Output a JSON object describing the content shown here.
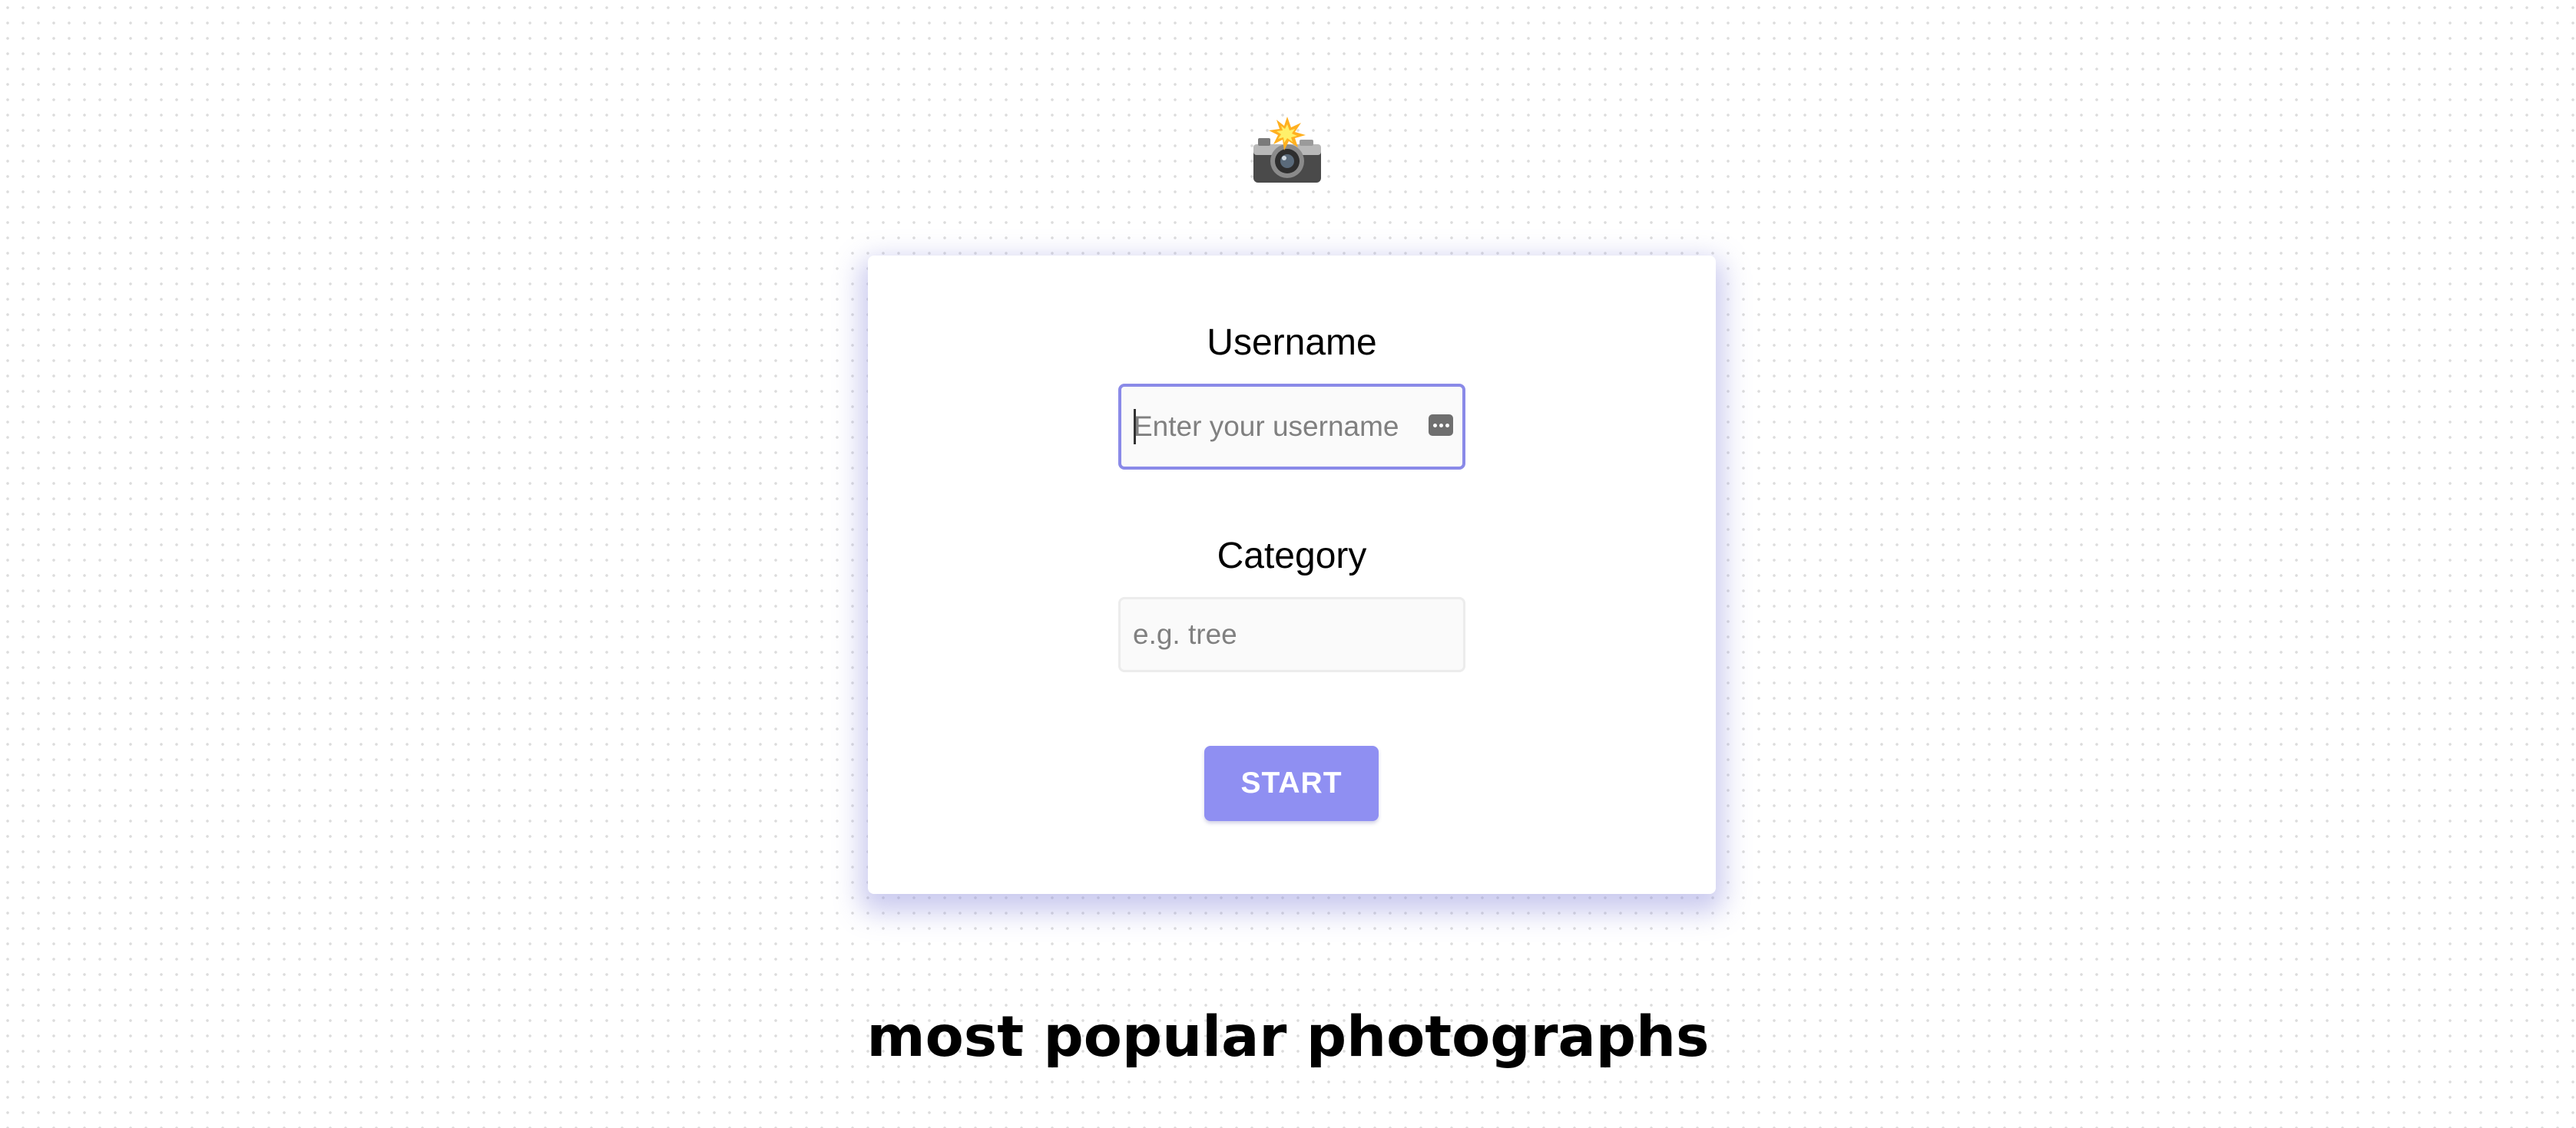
{
  "logo": {
    "icon": "camera-with-flash-icon"
  },
  "form": {
    "username_label": "Username",
    "username_placeholder": "Enter your username",
    "username_value": "",
    "category_label": "Category",
    "category_placeholder": "e.g. tree",
    "category_value": "",
    "start_label": "START",
    "accent_color": "#8f8ff2"
  },
  "popular": {
    "heading": "most popular photographs"
  }
}
